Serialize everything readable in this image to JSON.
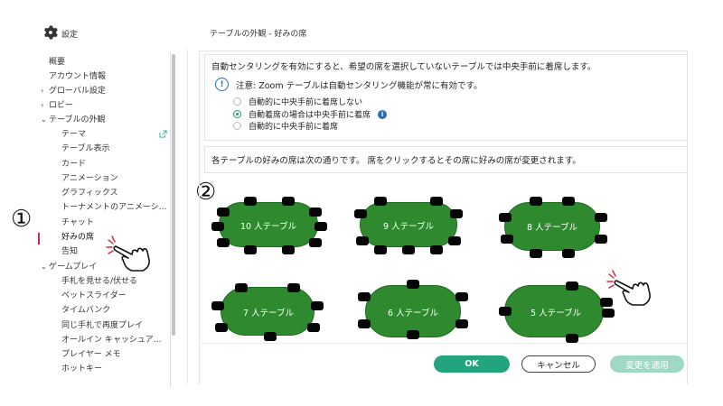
{
  "header": {
    "settings_label": "設定",
    "settings_icon": "gear-icon",
    "page_title": "テーブルの外観 - 好みの席"
  },
  "sidebar": {
    "items": [
      {
        "label": "概要",
        "level": 0
      },
      {
        "label": "アカウント情報",
        "level": 0
      },
      {
        "label": "グローバル設定",
        "level": 0,
        "chevron": ">"
      },
      {
        "label": "ロビー",
        "level": 0,
        "chevron": ">"
      },
      {
        "label": "テーブルの外観",
        "level": 0,
        "chevron": "v"
      },
      {
        "label": "テーマ",
        "level": 1
      },
      {
        "label": "テーブル表示",
        "level": 1
      },
      {
        "label": "カード",
        "level": 1
      },
      {
        "label": "アニメーション",
        "level": 1
      },
      {
        "label": "グラフィックス",
        "level": 1
      },
      {
        "label": "トーナメントのアニメーシ…",
        "level": 1
      },
      {
        "label": "チャット",
        "level": 1
      },
      {
        "label": "好みの席",
        "level": 1,
        "active": true
      },
      {
        "label": "告知",
        "level": 1
      },
      {
        "label": "ゲームプレイ",
        "level": 0,
        "chevron": "v"
      },
      {
        "label": "手札を見せる/伏せる",
        "level": 1
      },
      {
        "label": "ベットスライダー",
        "level": 1
      },
      {
        "label": "タイムバンク",
        "level": 1
      },
      {
        "label": "同じ手札で再度プレイ",
        "level": 1
      },
      {
        "label": "オールイン キャッシュア…",
        "level": 1
      },
      {
        "label": "プレイヤー メモ",
        "level": 1
      },
      {
        "label": "ホットキー",
        "level": 1
      }
    ],
    "accent_color": "#d9263c"
  },
  "annotations": {
    "marker_1": "①",
    "marker_2": "②"
  },
  "main": {
    "intro_text": "自動センタリングを有効にすると、希望の席を選択していないテーブルでは中央手前に着席します。",
    "notice_text": "注意: Zoom テーブルは自動センタリング機能が常に有効です。",
    "options": [
      {
        "label": "自動的に中央手前に着席しない",
        "checked": false
      },
      {
        "label": "自動着席の場合は中央手前に着席",
        "checked": true,
        "info": true
      },
      {
        "label": "自動的に中央手前に着席",
        "checked": false
      }
    ],
    "seats_text": "各テーブルの好みの席は次の通りです。 席をクリックするとその席に好みの席が変更されます。",
    "tables": [
      {
        "label": "10 人テーブル"
      },
      {
        "label": "9 人テーブル"
      },
      {
        "label": "8 人テーブル"
      },
      {
        "label": "7 人テーブル"
      },
      {
        "label": "6 人テーブル"
      },
      {
        "label": "5 人テーブル"
      }
    ],
    "table_color": "#2f8a2f"
  },
  "footer": {
    "ok_label": "OK",
    "cancel_label": "キャンセル",
    "apply_label": "変更を適用",
    "ok_color": "#22a57e"
  }
}
